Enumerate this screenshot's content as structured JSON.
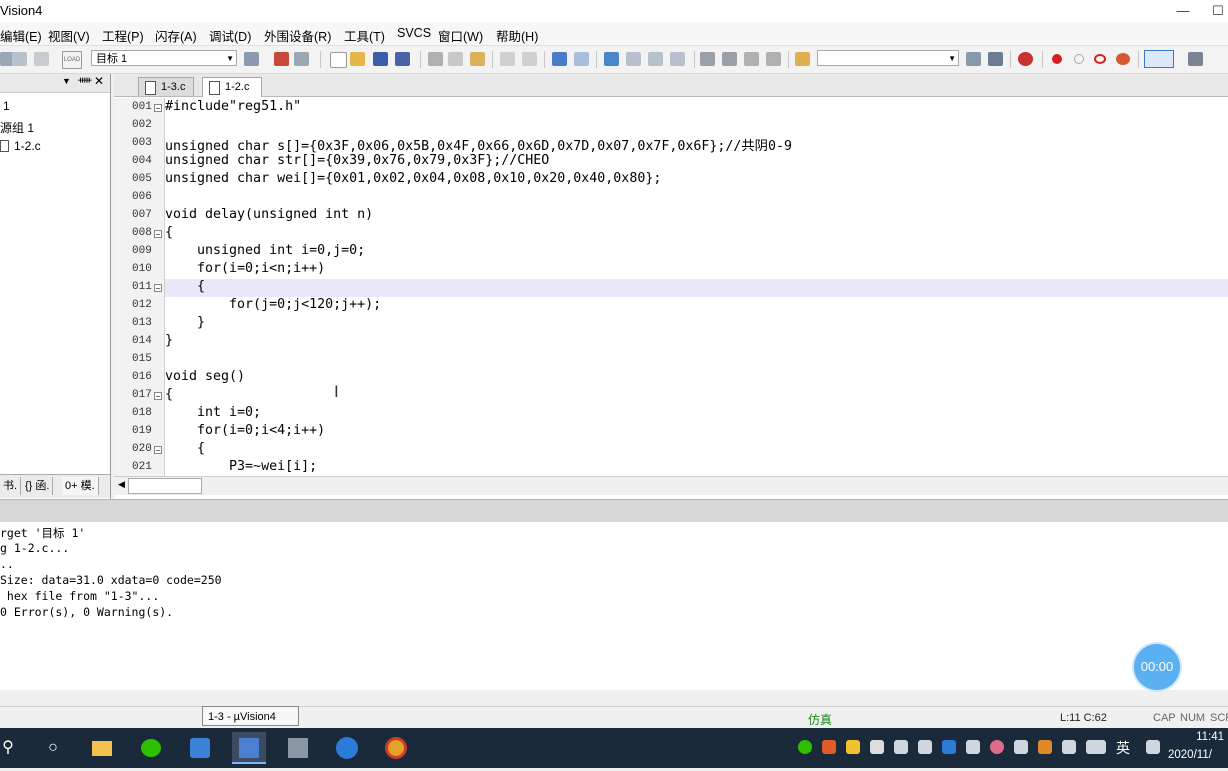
{
  "window": {
    "title": "Vision4",
    "controls": [
      "—",
      "☐"
    ]
  },
  "menu": [
    "编辑(E)",
    "视图(V)",
    "工程(P)",
    "闪存(A)",
    "调试(D)",
    "外围设备(R)",
    "工具(T)",
    "SVCS",
    "窗口(W)",
    "帮助(H)"
  ],
  "toolbar": {
    "target_label": "目标 1",
    "load_label": "LOAD"
  },
  "project": {
    "items": [
      "1",
      "源组 1",
      "1-2.c"
    ],
    "tabs": [
      "书.",
      "{} 函.",
      "0+ 模."
    ]
  },
  "editor": {
    "tabs": [
      {
        "label": "1-3.c",
        "active": false
      },
      {
        "label": "1-2.c",
        "active": true
      }
    ],
    "lines": [
      {
        "num": "001",
        "text": "#include\"reg51.h\"",
        "fold": "⊟"
      },
      {
        "num": "002",
        "text": ""
      },
      {
        "num": "003",
        "text": "unsigned char s[]={0x3F,0x06,0x5B,0x4F,0x66,0x6D,0x7D,0x07,0x7F,0x6F};//共阴0-9"
      },
      {
        "num": "004",
        "text": "unsigned char str[]={0x39,0x76,0x79,0x3F};//CHEO"
      },
      {
        "num": "005",
        "text": "unsigned char wei[]={0x01,0x02,0x04,0x08,0x10,0x20,0x40,0x80};"
      },
      {
        "num": "006",
        "text": ""
      },
      {
        "num": "007",
        "text": "void delay(unsigned int n)"
      },
      {
        "num": "008",
        "text": "{",
        "fold": "⊟"
      },
      {
        "num": "009",
        "text": "    unsigned int i=0,j=0;"
      },
      {
        "num": "010",
        "text": "    for(i=0;i<n;i++)"
      },
      {
        "num": "011",
        "text": "    {",
        "fold": "⊟"
      },
      {
        "num": "012",
        "text": "        for(j=0;j<120;j++);"
      },
      {
        "num": "013",
        "text": "    }"
      },
      {
        "num": "014",
        "text": "}"
      },
      {
        "num": "015",
        "text": ""
      },
      {
        "num": "016",
        "text": "void seg()"
      },
      {
        "num": "017",
        "text": "{",
        "fold": "⊟"
      },
      {
        "num": "018",
        "text": "    int i=0;"
      },
      {
        "num": "019",
        "text": "    for(i=0;i<4;i++)"
      },
      {
        "num": "020",
        "text": "    {",
        "fold": "⊟"
      },
      {
        "num": "021",
        "text": "        P3=~wei[i];"
      }
    ]
  },
  "build_output": [
    "rget '目标 1'",
    "g 1-2.c...",
    "..",
    "Size: data=31.0 xdata=0 code=250",
    " hex file from \"1-3\"...",
    "0 Error(s), 0 Warning(s)."
  ],
  "timer": "00:00",
  "status": {
    "tooltip": "1-3  - µVision4",
    "mode": "仿真",
    "position": "L:11 C:62",
    "indicators": [
      "CAP",
      "NUM",
      "SCR"
    ]
  },
  "taskbar": {
    "time": "11:41",
    "date": "2020/11/",
    "ime": "英"
  },
  "colors": {
    "current_line": "#e8e8f8",
    "mode_text": "#1a8a1a",
    "taskbar": "#1b2a3a"
  }
}
